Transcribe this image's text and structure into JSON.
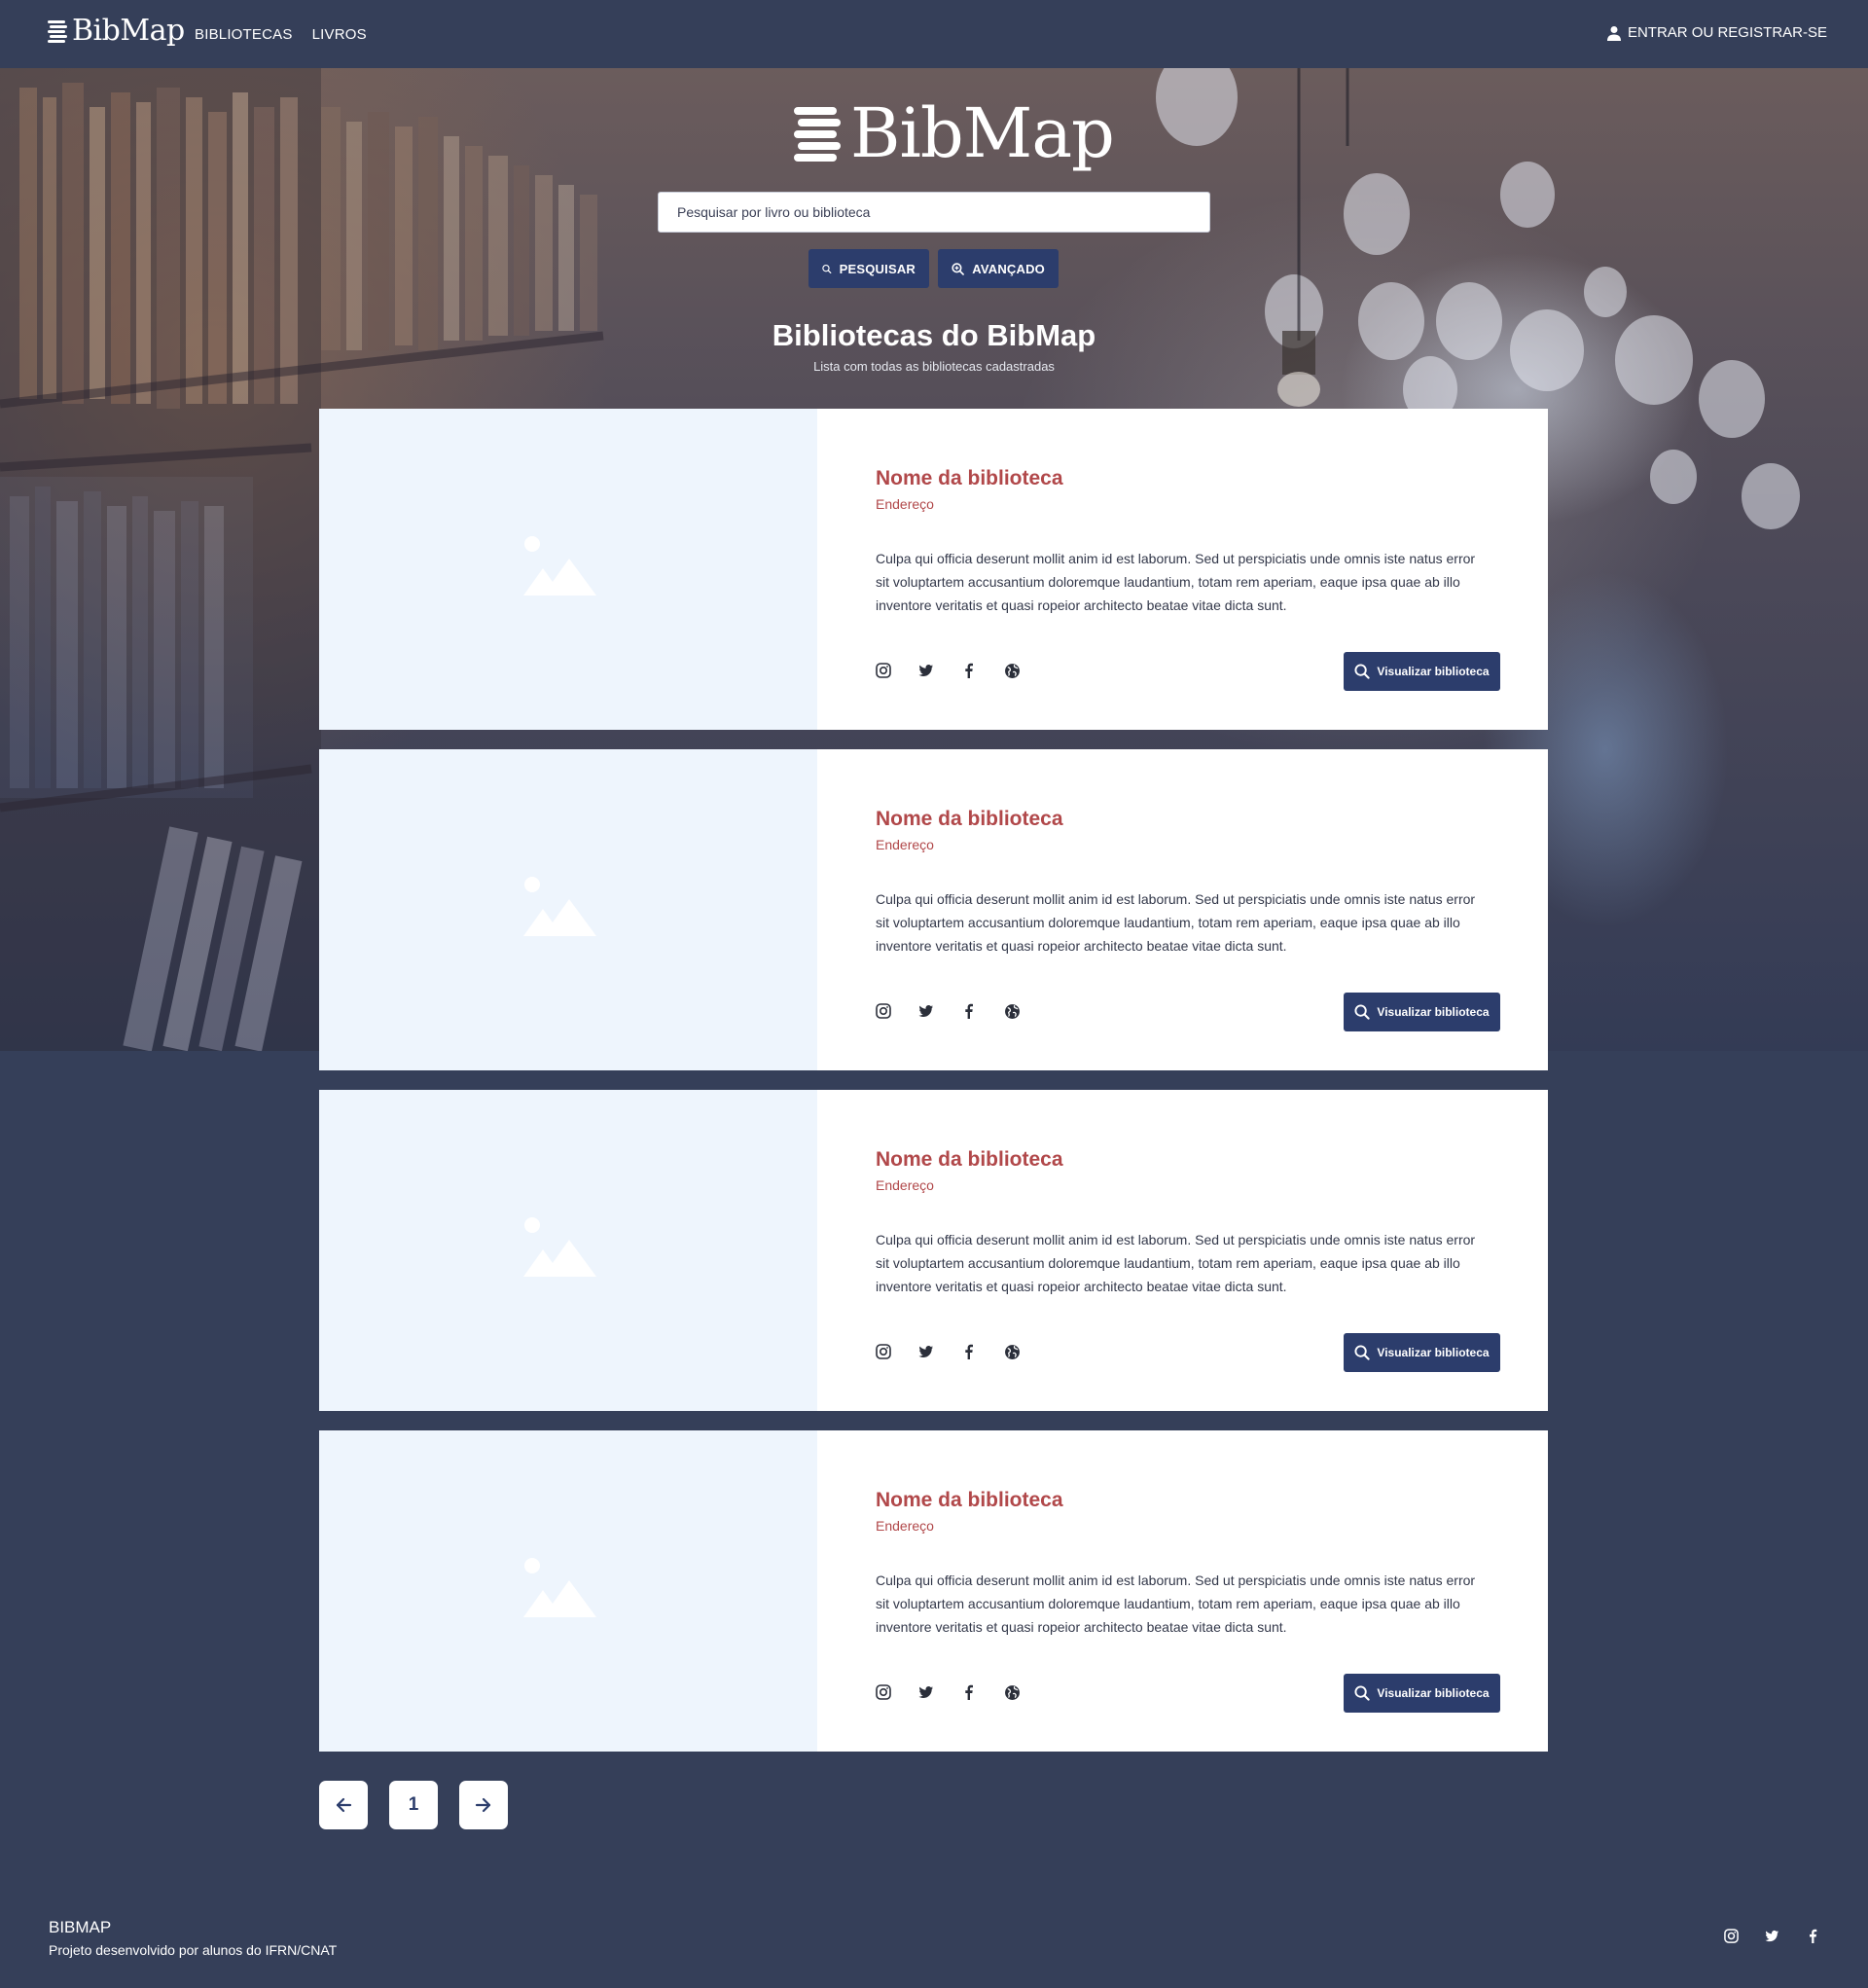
{
  "nav": {
    "logo_text": "BibMap",
    "links": [
      "BIBLIOTECAS",
      "LIVROS"
    ],
    "login_label": "ENTRAR OU REGISTRAR-SE"
  },
  "hero": {
    "logo_text": "BibMap",
    "search_placeholder": "Pesquisar por livro ou biblioteca",
    "search_button": "PESQUISAR",
    "advanced_button": "AVANÇADO",
    "title": "Bibliotecas do BibMap",
    "subtitle": "Lista com todas as bibliotecas cadastradas"
  },
  "libraries": [
    {
      "name": "Nome da biblioteca",
      "address": "Endereço",
      "description": "Culpa qui officia deserunt mollit anim id est laborum. Sed ut perspiciatis unde omnis iste natus error sit voluptartem accusantium doloremque laudantium, totam rem aperiam, eaque ipsa quae ab illo inventore veritatis et quasi ropeior architecto beatae vitae dicta sunt.",
      "view_button": "Visualizar biblioteca",
      "social_icons": [
        "instagram-icon",
        "twitter-icon",
        "facebook-icon",
        "globe-icon"
      ]
    },
    {
      "name": "Nome da biblioteca",
      "address": "Endereço",
      "description": "Culpa qui officia deserunt mollit anim id est laborum. Sed ut perspiciatis unde omnis iste natus error sit voluptartem accusantium doloremque laudantium, totam rem aperiam, eaque ipsa quae ab illo inventore veritatis et quasi ropeior architecto beatae vitae dicta sunt.",
      "view_button": "Visualizar biblioteca",
      "social_icons": [
        "instagram-icon",
        "twitter-icon",
        "facebook-icon",
        "globe-icon"
      ]
    },
    {
      "name": "Nome da biblioteca",
      "address": "Endereço",
      "description": "Culpa qui officia deserunt mollit anim id est laborum. Sed ut perspiciatis unde omnis iste natus error sit voluptartem accusantium doloremque laudantium, totam rem aperiam, eaque ipsa quae ab illo inventore veritatis et quasi ropeior architecto beatae vitae dicta sunt.",
      "view_button": "Visualizar biblioteca",
      "social_icons": [
        "instagram-icon",
        "twitter-icon",
        "facebook-icon",
        "globe-icon"
      ]
    },
    {
      "name": "Nome da biblioteca",
      "address": "Endereço",
      "description": "Culpa qui officia deserunt mollit anim id est laborum. Sed ut perspiciatis unde omnis iste natus error sit voluptartem accusantium doloremque laudantium, totam rem aperiam, eaque ipsa quae ab illo inventore veritatis et quasi ropeior architecto beatae vitae dicta sunt.",
      "view_button": "Visualizar biblioteca",
      "social_icons": [
        "instagram-icon",
        "twitter-icon",
        "facebook-icon",
        "globe-icon"
      ]
    }
  ],
  "pagination": {
    "prev_icon": "arrow-left-icon",
    "current_page": "1",
    "next_icon": "arrow-right-icon"
  },
  "footer": {
    "title": "BIBMAP",
    "subtitle": "Projeto desenvolvido por alunos do IFRN/CNAT",
    "social_icons": [
      "instagram-icon",
      "twitter-icon",
      "facebook-icon"
    ]
  },
  "colors": {
    "background": "#353f59",
    "primary_button": "#2c3d6c",
    "accent_text": "#b1484a",
    "image_placeholder": "#eef5fd"
  }
}
